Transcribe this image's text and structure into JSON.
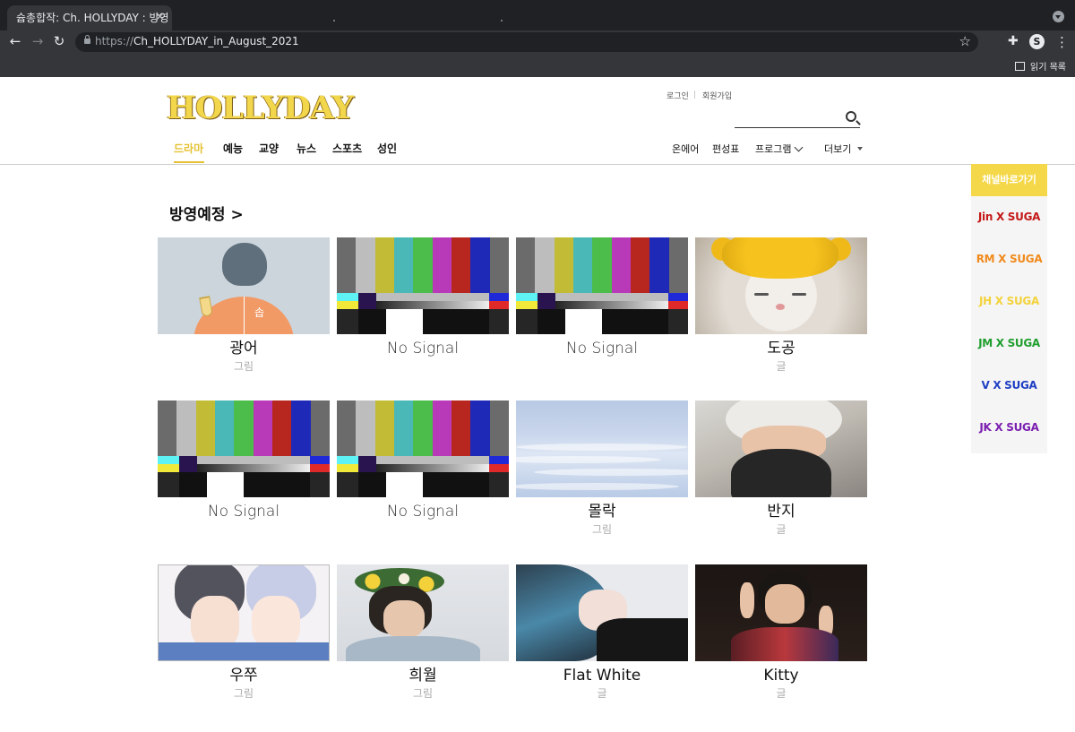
{
  "browser": {
    "tab_title": "슙총합작: Ch. HOLLYDAY : 방영",
    "tab_close": "✕",
    "url_scheme": "https://",
    "url_host": "Ch_HOLLYDAY_in_August_2021",
    "reading_list": "읽기 목록"
  },
  "site": {
    "logo": "HOLLYDAY",
    "login": "로그인",
    "signup": "회원가입",
    "gnb": [
      "드라마",
      "예능",
      "교양",
      "뉴스",
      "스포츠",
      "성인"
    ],
    "active_gnb": "드라마",
    "right_menu": [
      "온에어",
      "편성표",
      "프로그램",
      "더보기"
    ]
  },
  "section": {
    "title": "방영예정 >"
  },
  "cards": [
    {
      "title": "광어",
      "sub": "그림",
      "thumb": "illustration-flatfish",
      "ad_label": "솝"
    },
    {
      "title": "No Signal",
      "sub": "",
      "thumb": "color-bars"
    },
    {
      "title": "No Signal",
      "sub": "",
      "thumb": "color-bars"
    },
    {
      "title": "도공",
      "sub": "글",
      "thumb": "photo-cat"
    },
    {
      "title": "No Signal",
      "sub": "",
      "thumb": "color-bars"
    },
    {
      "title": "No Signal",
      "sub": "",
      "thumb": "color-bars"
    },
    {
      "title": "몰락",
      "sub": "그림",
      "thumb": "illustration-sea"
    },
    {
      "title": "반지",
      "sub": "글",
      "thumb": "photo-mask"
    },
    {
      "title": "우쭈",
      "sub": "그림",
      "thumb": "illustration-couple"
    },
    {
      "title": "희월",
      "sub": "그림",
      "thumb": "photo-flowers"
    },
    {
      "title": "Flat White",
      "sub": "글",
      "thumb": "illustration-blue-hair"
    },
    {
      "title": "Kitty",
      "sub": "글",
      "thumb": "photo-peace"
    }
  ],
  "channel_panel": {
    "title": "채널바로가기",
    "items": [
      {
        "label": "Jin X SUGA",
        "color": "#c41818"
      },
      {
        "label": "RM X SUGA",
        "color": "#f08a1c"
      },
      {
        "label": "JH X SUGA",
        "color": "#f3d23a"
      },
      {
        "label": "JM X SUGA",
        "color": "#1f9e2e"
      },
      {
        "label": "V X SUGA",
        "color": "#1f3fc4"
      },
      {
        "label": "JK X SUGA",
        "color": "#7b1fb0"
      }
    ],
    "header_color": "#f5d84a"
  }
}
